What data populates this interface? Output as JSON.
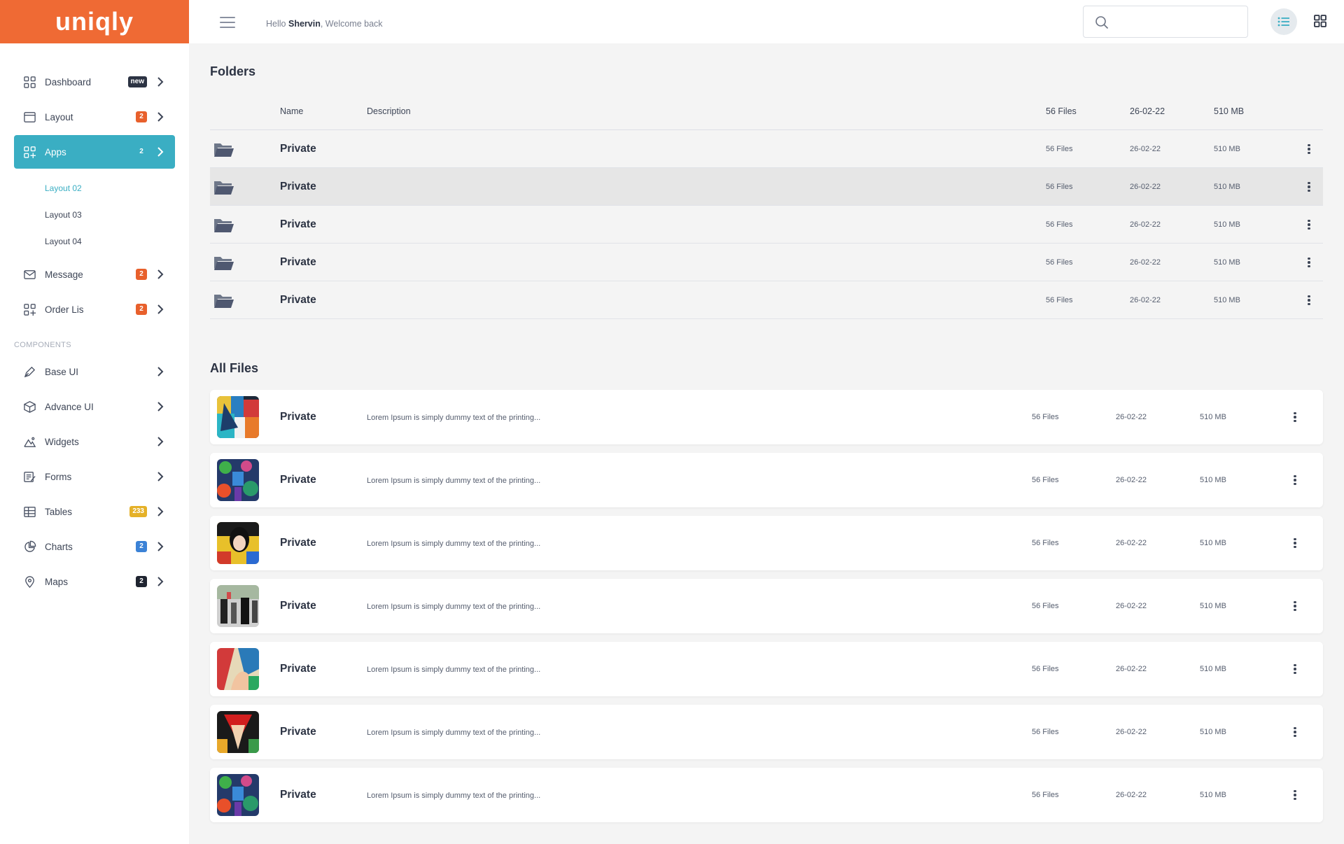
{
  "brand": {
    "name": "uniqly",
    "color": "#ef6a34"
  },
  "header": {
    "greeting_prefix": "Hello",
    "user_name": "Shervin",
    "greeting_suffix": ", Welcome back",
    "search_placeholder": ""
  },
  "sidebar": {
    "items": [
      {
        "label": "Dashboard",
        "badge": "new",
        "badge_color": "#2c3343",
        "icon": "grid-icon"
      },
      {
        "label": "Layout",
        "badge": "2",
        "badge_color": "#e8602c",
        "icon": "browser-window-icon"
      },
      {
        "label": "Apps",
        "badge": "2",
        "badge_color": "#3aaec3",
        "icon": "apps-grid-icon",
        "active": true
      },
      {
        "label": "Message",
        "badge": "2",
        "badge_color": "#e8602c",
        "icon": "envelope-icon"
      },
      {
        "label": "Order Lis",
        "badge": "2",
        "badge_color": "#e8602c",
        "icon": "apps-grid-icon"
      }
    ],
    "sub_items": [
      {
        "label": "Layout 02",
        "active": true
      },
      {
        "label": "Layout 03"
      },
      {
        "label": "Layout 04"
      }
    ],
    "components_title": "COMPONENTS",
    "components": [
      {
        "label": "Base UI",
        "badge": "",
        "icon": "pen-icon"
      },
      {
        "label": "Advance UI",
        "badge": "",
        "icon": "cube-icon"
      },
      {
        "label": "Widgets",
        "badge": "",
        "icon": "mountain-icon"
      },
      {
        "label": "Forms",
        "badge": "",
        "icon": "form-icon"
      },
      {
        "label": "Tables",
        "badge": "233",
        "badge_color": "#e5b128",
        "icon": "table-icon"
      },
      {
        "label": "Charts",
        "badge": "2",
        "badge_color": "#3b82d6",
        "icon": "pie-chart-icon"
      },
      {
        "label": "Maps",
        "badge": "2",
        "badge_color": "#1f2430",
        "icon": "map-pin-icon"
      }
    ]
  },
  "folders": {
    "title": "Folders",
    "columns": {
      "name": "Name",
      "description": "Description",
      "files": "56 Files",
      "date": "26-02-22",
      "size": "510 MB"
    },
    "rows": [
      {
        "name": "Private",
        "files": "56 Files",
        "date": "26-02-22",
        "size": "510 MB"
      },
      {
        "name": "Private",
        "files": "56 Files",
        "date": "26-02-22",
        "size": "510 MB",
        "highlighted": true
      },
      {
        "name": "Private",
        "files": "56 Files",
        "date": "26-02-22",
        "size": "510 MB"
      },
      {
        "name": "Private",
        "files": "56 Files",
        "date": "26-02-22",
        "size": "510 MB"
      },
      {
        "name": "Private",
        "files": "56 Files",
        "date": "26-02-22",
        "size": "510 MB"
      }
    ]
  },
  "all_files": {
    "title": "All Files",
    "rows": [
      {
        "name": "Private",
        "description": "Lorem Ipsum is simply dummy text of the printing...",
        "files": "56 Files",
        "date": "26-02-22",
        "size": "510 MB"
      },
      {
        "name": "Private",
        "description": "Lorem Ipsum is simply dummy text of the printing...",
        "files": "56 Files",
        "date": "26-02-22",
        "size": "510 MB"
      },
      {
        "name": "Private",
        "description": "Lorem Ipsum is simply dummy text of the printing...",
        "files": "56 Files",
        "date": "26-02-22",
        "size": "510 MB"
      },
      {
        "name": "Private",
        "description": "Lorem Ipsum is simply dummy text of the printing...",
        "files": "56 Files",
        "date": "26-02-22",
        "size": "510 MB"
      },
      {
        "name": "Private",
        "description": "Lorem Ipsum is simply dummy text of the printing...",
        "files": "56 Files",
        "date": "26-02-22",
        "size": "510 MB"
      },
      {
        "name": "Private",
        "description": "Lorem Ipsum is simply dummy text of the printing...",
        "files": "56 Files",
        "date": "26-02-22",
        "size": "510 MB"
      },
      {
        "name": "Private",
        "description": "Lorem Ipsum is simply dummy text of the printing...",
        "files": "56 Files",
        "date": "26-02-22",
        "size": "510 MB"
      }
    ]
  },
  "colors": {
    "accent": "#3aaec3",
    "folder": "#5b6478"
  }
}
